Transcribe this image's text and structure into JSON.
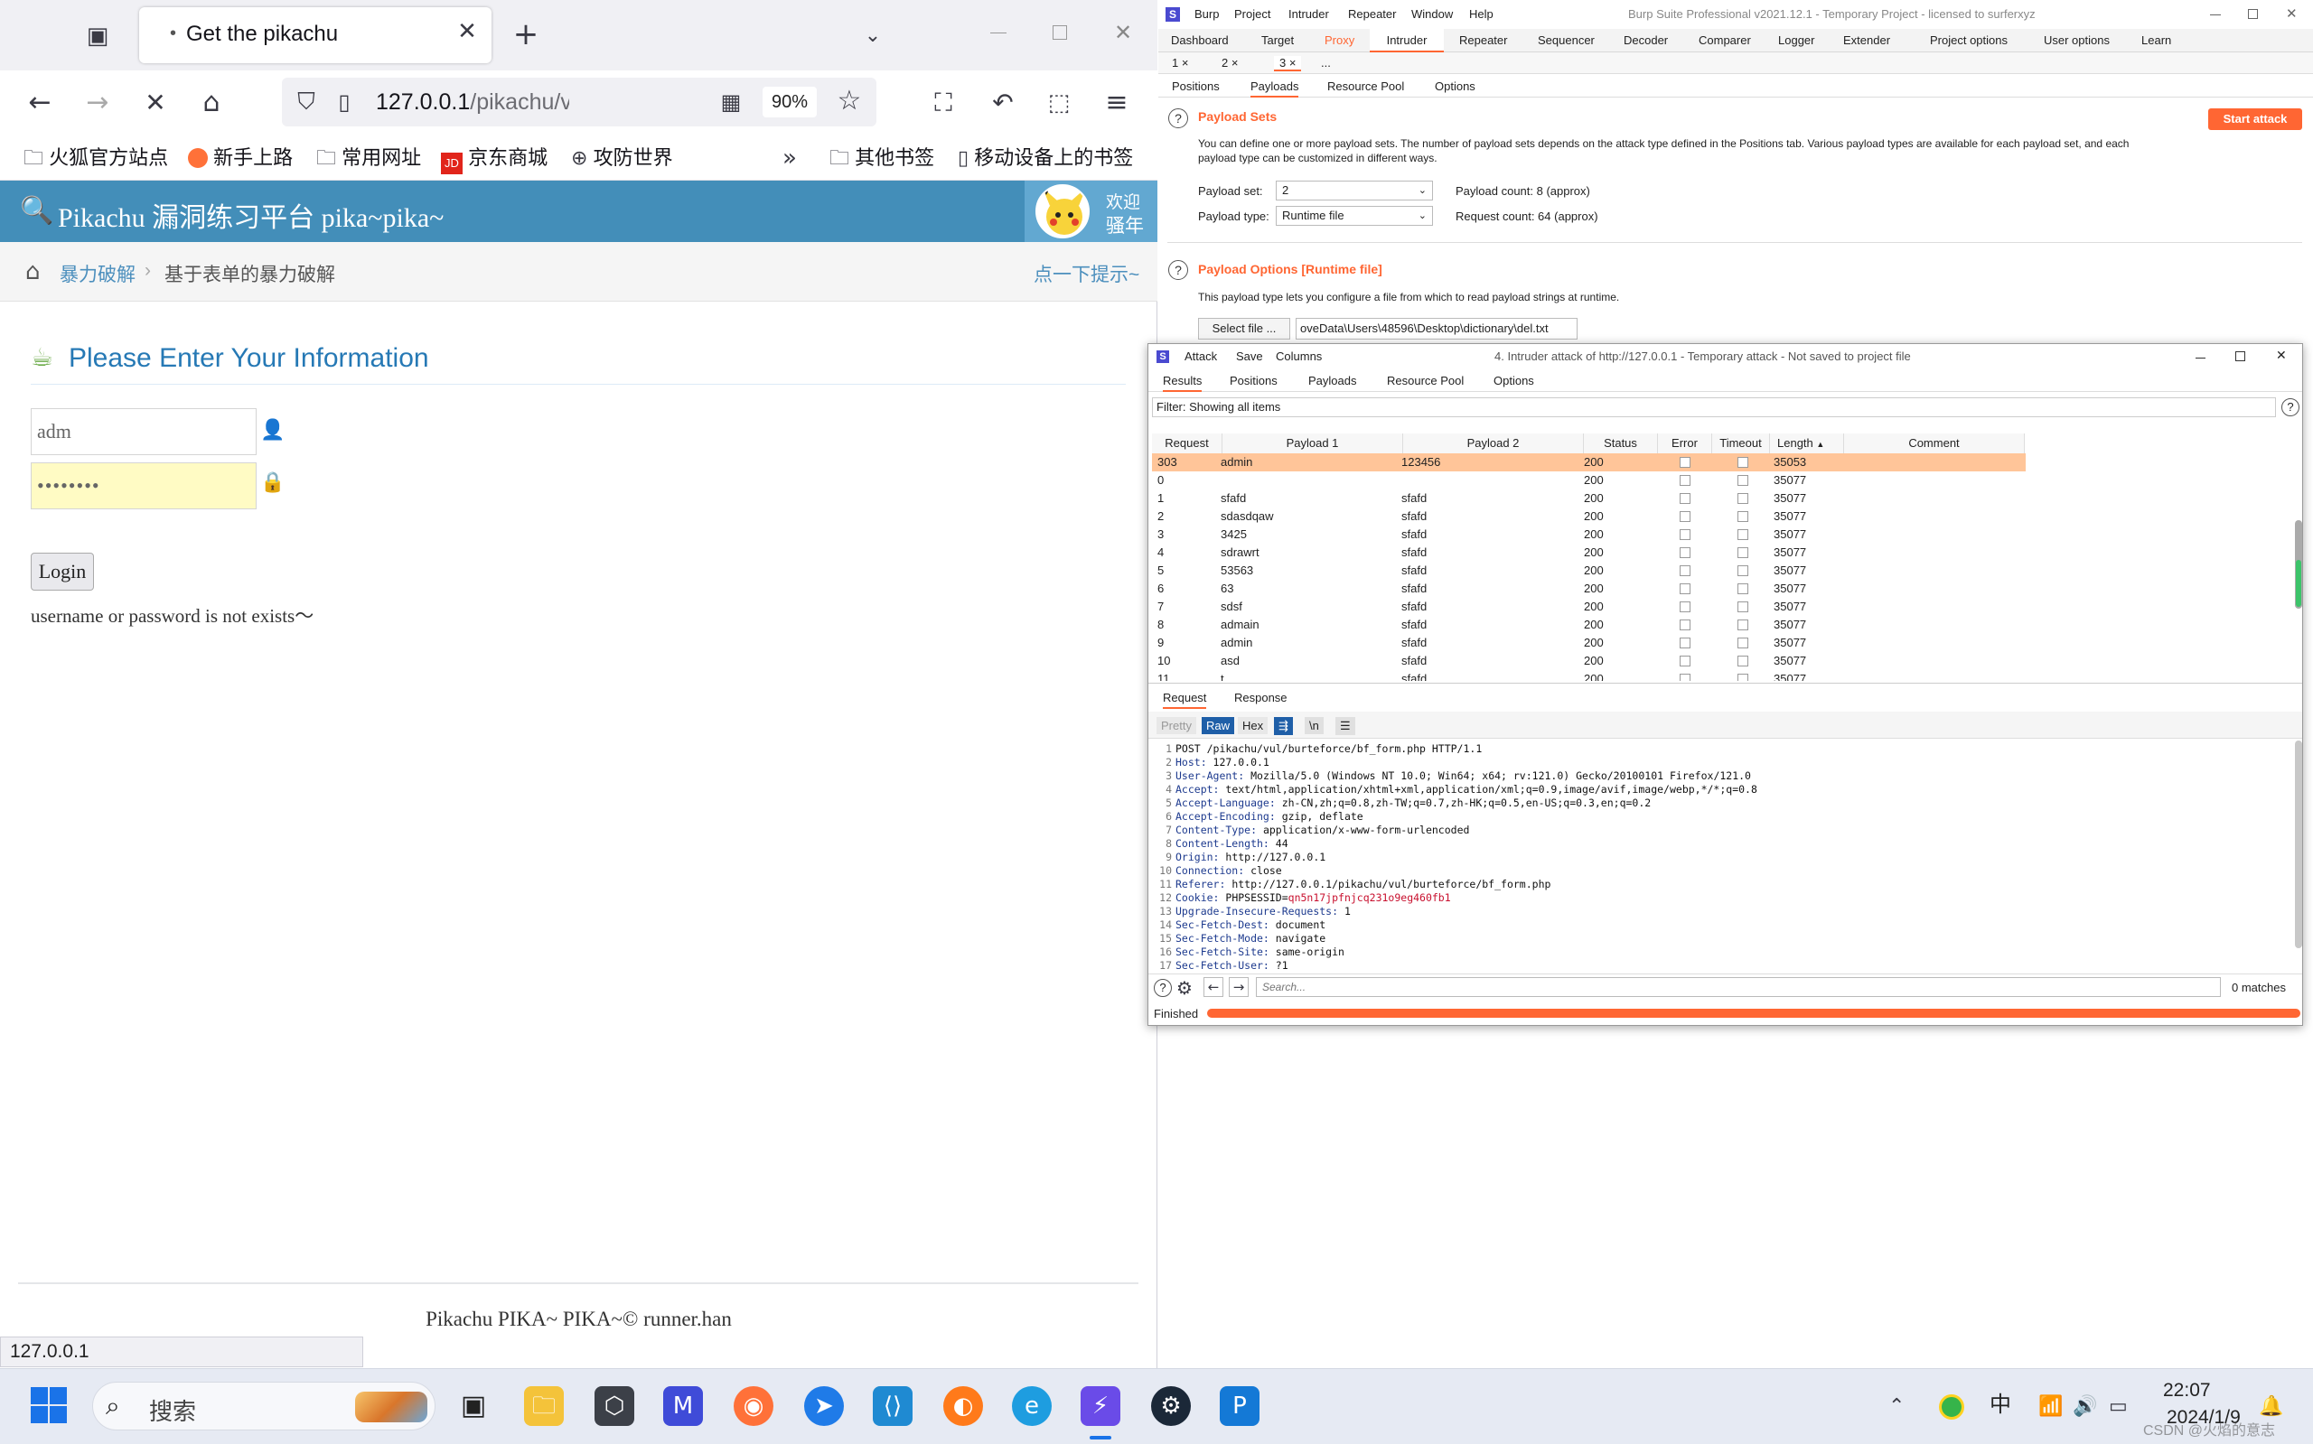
{
  "firefox": {
    "tab_title": "Get the pikachu",
    "url_host": "127.0.0.1",
    "url_path": "/pikachu/vul/burtefor",
    "zoom": "90%",
    "bookmarks": [
      "火狐官方站点",
      "新手上路",
      "常用网址",
      "京东商城",
      "攻防世界"
    ],
    "bookmarks_right": [
      "其他书签",
      "移动设备上的书签"
    ],
    "status_url": "127.0.0.1"
  },
  "pikachu": {
    "title": "Pikachu 漏洞练习平台 pika~pika~",
    "welcome_1": "欢迎",
    "welcome_2": "骚年",
    "crumb_home": "暴力破解",
    "crumb_current": "基于表单的暴力破解",
    "hint_link": "点一下提示~",
    "form_title": "Please Enter Your Information",
    "username_value": "adm",
    "password_mask": "••••••••",
    "login_label": "Login",
    "message": "username or password is not exists～",
    "footer": "Pikachu PIKA~ PIKA~© runner.han"
  },
  "burp": {
    "menu": [
      "Burp",
      "Project",
      "Intruder",
      "Repeater",
      "Window",
      "Help"
    ],
    "window_title": "Burp Suite Professional v2021.12.1 - Temporary Project - licensed to surferxyz",
    "tabs": [
      "Dashboard",
      "Target",
      "Proxy",
      "Intruder",
      "Repeater",
      "Sequencer",
      "Decoder",
      "Comparer",
      "Logger",
      "Extender",
      "Project options",
      "User options",
      "Learn"
    ],
    "sub_tabs": [
      "1 ×",
      "2 ×",
      "3 ×",
      "..."
    ],
    "intruder_tabs": [
      "Positions",
      "Payloads",
      "Resource Pool",
      "Options"
    ],
    "payload_sets_title": "Payload Sets",
    "start_attack": "Start attack",
    "payload_sets_desc_1": "You can define one or more payload sets. The number of payload sets depends on the attack type defined in the Positions tab. Various payload types are available for each payload set, and each",
    "payload_sets_desc_2": "payload type can be customized in different ways.",
    "payload_set_label": "Payload set:",
    "payload_set_value": "2",
    "payload_count": "Payload count: 8 (approx)",
    "payload_type_label": "Payload type:",
    "payload_type_value": "Runtime file",
    "request_count": "Request count: 64 (approx)",
    "payload_options_title": "Payload Options [Runtime file]",
    "payload_options_desc": "This payload type lets you configure a file from which to read payload strings at runtime.",
    "select_file": "Select file ...",
    "file_path": "oveData\\Users\\48596\\Desktop\\dictionary\\del.txt"
  },
  "attack": {
    "menu": [
      "Attack",
      "Save",
      "Columns"
    ],
    "title": "4. Intruder attack of http://127.0.0.1 - Temporary attack - Not saved to project file",
    "tabs": [
      "Results",
      "Positions",
      "Payloads",
      "Resource Pool",
      "Options"
    ],
    "filter": "Filter: Showing all items",
    "columns": [
      "Request",
      "Payload 1",
      "Payload 2",
      "Status",
      "Error",
      "Timeout",
      "Length",
      "Comment"
    ],
    "rows": [
      [
        "303",
        "admin",
        "123456",
        "200",
        "35053"
      ],
      [
        "0",
        "",
        "",
        "200",
        "35077"
      ],
      [
        "1",
        "sfafd",
        "sfafd",
        "200",
        "35077"
      ],
      [
        "2",
        "sdasdqaw",
        "sfafd",
        "200",
        "35077"
      ],
      [
        "3",
        "3425",
        "sfafd",
        "200",
        "35077"
      ],
      [
        "4",
        "sdrawrt",
        "sfafd",
        "200",
        "35077"
      ],
      [
        "5",
        "53563",
        "sfafd",
        "200",
        "35077"
      ],
      [
        "6",
        "63",
        "sfafd",
        "200",
        "35077"
      ],
      [
        "7",
        "sdsf",
        "sfafd",
        "200",
        "35077"
      ],
      [
        "8",
        "admain",
        "sfafd",
        "200",
        "35077"
      ],
      [
        "9",
        "admin",
        "sfafd",
        "200",
        "35077"
      ],
      [
        "10",
        "asd",
        "sfafd",
        "200",
        "35077"
      ],
      [
        "11",
        "t",
        "sfafd",
        "200",
        "35077"
      ]
    ],
    "detail_tabs": [
      "Request",
      "Response"
    ],
    "view_buttons": [
      "Pretty",
      "Raw",
      "Hex",
      "\\n"
    ],
    "request_lines": [
      {
        "k": "POST /pikachu/vul/burteforce/bf_form.php HTTP/1.1",
        "v": ""
      },
      {
        "k": "Host:",
        "v": " 127.0.0.1"
      },
      {
        "k": "User-Agent:",
        "v": " Mozilla/5.0 (Windows NT 10.0; Win64; x64; rv:121.0) Gecko/20100101 Firefox/121.0"
      },
      {
        "k": "Accept:",
        "v": " text/html,application/xhtml+xml,application/xml;q=0.9,image/avif,image/webp,*/*;q=0.8"
      },
      {
        "k": "Accept-Language:",
        "v": " zh-CN,zh;q=0.8,zh-TW;q=0.7,zh-HK;q=0.5,en-US;q=0.3,en;q=0.2"
      },
      {
        "k": "Accept-Encoding:",
        "v": " gzip, deflate"
      },
      {
        "k": "Content-Type:",
        "v": " application/x-www-form-urlencoded"
      },
      {
        "k": "Content-Length:",
        "v": " 44"
      },
      {
        "k": "Origin:",
        "v": " http://127.0.0.1"
      },
      {
        "k": "Connection:",
        "v": " close"
      },
      {
        "k": "Referer:",
        "v": " http://127.0.0.1/pikachu/vul/burteforce/bf_form.php"
      },
      {
        "k": "Cookie:",
        "v": " PHPSESSID=",
        "c": "qn5n17jpfnjcq231o9eg460fb1"
      },
      {
        "k": "Upgrade-Insecure-Requests:",
        "v": " 1"
      },
      {
        "k": "Sec-Fetch-Dest:",
        "v": " document"
      },
      {
        "k": "Sec-Fetch-Mode:",
        "v": " navigate"
      },
      {
        "k": "Sec-Fetch-Site:",
        "v": " same-origin"
      },
      {
        "k": "Sec-Fetch-User:",
        "v": " ?1"
      }
    ],
    "search_placeholder": "Search...",
    "matches": "0 matches",
    "status": "Finished",
    "progress": 1.0
  },
  "taskbar": {
    "search_placeholder": "搜索",
    "ime": "中",
    "time": "22:07",
    "date": "2024/1/9",
    "watermark": "CSDN @火焰的意志"
  },
  "colors": {
    "pikachu_blue": "#438eb9",
    "burp_orange": "#ff6633",
    "row_highlight": "#ffc599"
  }
}
